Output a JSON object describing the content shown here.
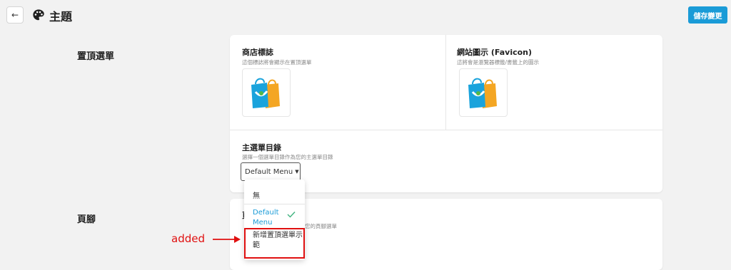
{
  "header": {
    "title": "主題",
    "save_label": "儲存變更",
    "back_icon": "arrow-left-icon",
    "title_icon": "palette-icon"
  },
  "sections": {
    "top_menu_label": "置頂選單",
    "footer_label": "頁腳"
  },
  "shop_logo": {
    "title": "商店標誌",
    "hint": "這個標誌將會顯示在置頂選單"
  },
  "favicon": {
    "title": "網站圖示 (Favicon)",
    "hint": "這將會是瀏覽器標籤/書籤上的圖示"
  },
  "main_menu": {
    "title": "主選單目錄",
    "hint": "選擇一個選單目錄作為您的主選單目錄",
    "selected": "Default Menu",
    "options": [
      "無",
      "Default Menu",
      "新增置頂選單示範"
    ]
  },
  "footer_card": {
    "title_peek": "頁",
    "hint_peek": "您的頁腳選單"
  },
  "annotation": {
    "label": "added",
    "color": "#e01010"
  },
  "colors": {
    "accent": "#1a9bd7",
    "background": "#f2f2f2"
  }
}
